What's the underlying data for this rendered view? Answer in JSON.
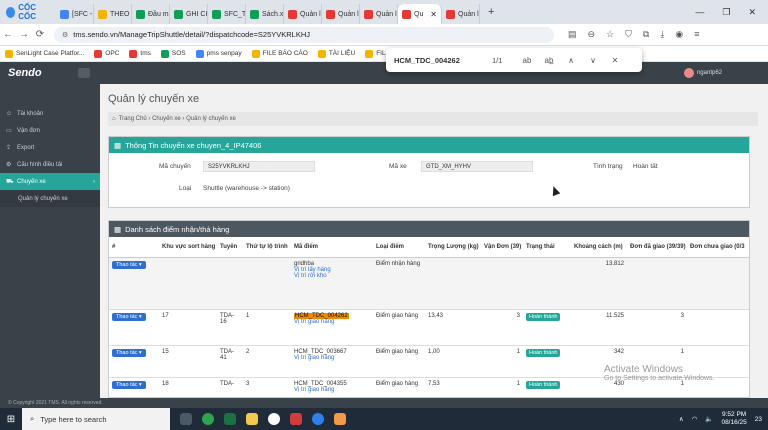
{
  "browser": {
    "brand": "CỐC CỐC",
    "tabs": [
      {
        "label": "[SFC -",
        "color": "#4285f4"
      },
      {
        "label": "THEO",
        "color": "#f4b400"
      },
      {
        "label": "Đầu m",
        "color": "#0f9d58"
      },
      {
        "label": "GHI CH",
        "color": "#0f9d58"
      },
      {
        "label": "SFC_Th",
        "color": "#0f9d58"
      },
      {
        "label": "Sách.xl",
        "color": "#0f9d58"
      },
      {
        "label": "Quản l",
        "color": "#e53935"
      },
      {
        "label": "Quản l",
        "color": "#e53935"
      },
      {
        "label": "Quản l",
        "color": "#e53935"
      },
      {
        "label": "Qu",
        "color": "#e53935",
        "active": true
      },
      {
        "label": "Quản l",
        "color": "#e53935"
      }
    ],
    "url": "tms.sendo.vn/ManageTripShuttle/detail/?dispatchcode=S25YVKRLKHJ",
    "bookmarks": [
      {
        "label": "SenLight Case Platfor...",
        "color": "#f4b400"
      },
      {
        "label": "OPC",
        "color": "#e53935"
      },
      {
        "label": "tms",
        "color": "#e53935"
      },
      {
        "label": "SOS",
        "color": "#0f9d58"
      },
      {
        "label": "pms senpay",
        "color": "#4285f4"
      },
      {
        "label": "FILE BÁO CÁO",
        "color": "#f4b400"
      },
      {
        "label": "TÀI LIỆU",
        "color": "#f4b400"
      },
      {
        "label": "FIL",
        "color": "#f4b400"
      }
    ],
    "find": {
      "query": "HCM_TDC_004262",
      "count": "1/1",
      "ab": "ab",
      "ab2": "ab̲"
    }
  },
  "app": {
    "brand": "Sendo",
    "username": "ngantp62",
    "sidebar": [
      {
        "label": "Tài khoản",
        "icon": "user-icon"
      },
      {
        "label": "Vận đơn",
        "icon": "file-icon"
      },
      {
        "label": "Export",
        "icon": "export-icon"
      },
      {
        "label": "Cấu hình điều tải",
        "icon": "gear-icon"
      },
      {
        "label": "Chuyến xe",
        "icon": "truck-icon",
        "active": true
      }
    ],
    "sidebar_sub": "Quản lý chuyến xe",
    "page_title": "Quản lý chuyến xe",
    "breadcrumb": "Trang Chủ › Chuyến xe › Quản lý chuyến xe",
    "info": {
      "heading": "Thông Tin chuyến xe chuyen_4_IP47406",
      "l_code": "Mã chuyến",
      "v_code": "S25YVKRLKHJ",
      "l_car": "Mã xe",
      "v_car": "GTD_XM_HYHV",
      "l_status": "Tình trạng",
      "v_status": "Hoàn tất",
      "l_type": "Loại",
      "v_type": "Shuttle (warehouse -> station)"
    },
    "list": {
      "heading": "Danh sách điểm nhận/thả hàng",
      "columns": [
        "#",
        "Khu vực sort hàng",
        "Tuyến",
        "Thứ tự lộ trình",
        "Mã điểm",
        "Loại điểm",
        "Trọng Lượng (kg)",
        "Vận Đơn (39)",
        "Trạng thái",
        "Khoảng cách (m)",
        "Đơn đã giao (39/39)",
        "Đơn chưa giao (0/3"
      ],
      "action": "Thao tác ▾",
      "rows": [
        {
          "sort": "",
          "route": "",
          "order": "",
          "code": "gridhba",
          "links": [
            "Vị trí lấy hàng",
            "Vị trí rời kho"
          ],
          "type": "Điểm nhận hàng",
          "weight": "",
          "bills": "",
          "status": "",
          "distance": "13.812",
          "delivered": "",
          "pending": "",
          "hl": false
        },
        {
          "sort": "17",
          "route": "TDA-16",
          "order": "1",
          "code": "HCM_TDC_004262",
          "links": [
            "Vị trí giao hàng"
          ],
          "type": "Điểm giao hàng",
          "weight": "13,43",
          "bills": "3",
          "status": "Hoàn thành",
          "distance": "11.525",
          "delivered": "3",
          "pending": "",
          "hl": true
        },
        {
          "sort": "15",
          "route": "TDA-41",
          "order": "2",
          "code": "HCM_TDC_003667",
          "links": [
            "Vị trí giao hàng"
          ],
          "type": "Điểm giao hàng",
          "weight": "1,00",
          "bills": "1",
          "status": "Hoàn thành",
          "distance": "342",
          "delivered": "1",
          "pending": "",
          "hl": false
        },
        {
          "sort": "18",
          "route": "TDA-",
          "order": "3",
          "code": "HCM_TDC_004355",
          "links": [
            "Vị trí giao hàng"
          ],
          "type": "Điểm giao hàng",
          "weight": "7,53",
          "bills": "1",
          "status": "Hoàn thành",
          "distance": "430",
          "delivered": "1",
          "pending": "",
          "hl": false
        }
      ]
    },
    "footer": "© Copyright 2021 TMS. All rights reserved."
  },
  "windows": {
    "activate": "Activate Windows",
    "activate_sub": "Go to Settings to activate Windows.",
    "search": "Type here to search",
    "time": "9:52 PM",
    "date": "08/16/25",
    "notif": "23"
  }
}
